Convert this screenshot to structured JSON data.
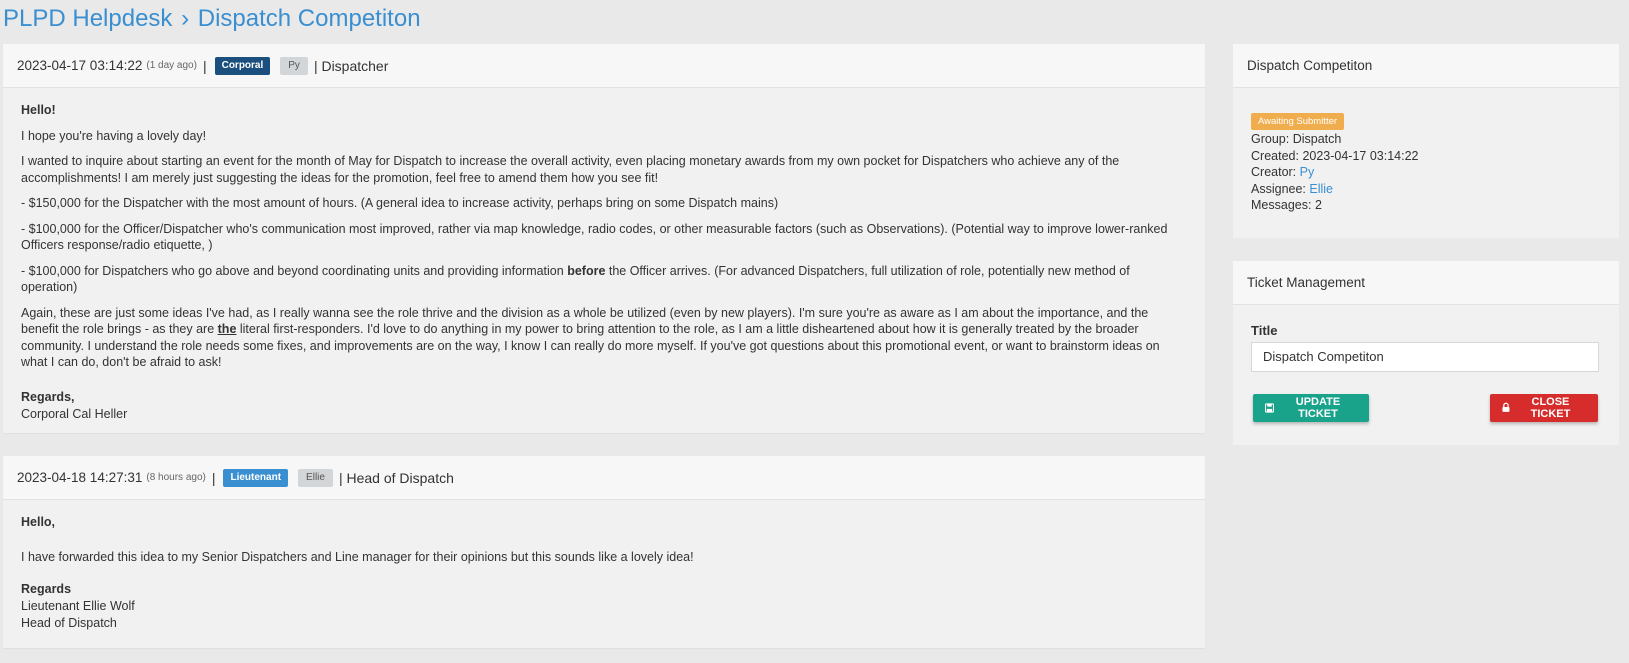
{
  "breadcrumb": {
    "root": "PLPD Helpdesk",
    "separator": "›",
    "current": "Dispatch Competiton"
  },
  "colors": {
    "accent": "#3a8fd1",
    "corporal_badge": "#1a4f7e",
    "lieutenant_badge": "#3a8fd1",
    "awaiting_badge": "#f0ad4e",
    "update_button": "#1aa38b",
    "close_button": "#d62c2c"
  },
  "messages": [
    {
      "timestamp": "2023-04-17 03:14:22",
      "ago": "(1 day ago)",
      "pipe": "|",
      "rank": "Corporal",
      "user": "Py",
      "role": "| Dispatcher",
      "greeting": "Hello!",
      "p1": "I hope you're having a lovely day!",
      "p2": "I wanted to inquire about starting an event for the month of May for Dispatch to increase the overall activity, even placing monetary awards from my own pocket for Dispatchers who achieve any of the accomplishments! I am merely just suggesting the ideas for the promotion, feel free to amend them how you see fit!",
      "b1": "- $150,000 for the Dispatcher with the most amount of hours. (A general idea to increase activity, perhaps bring on some Dispatch mains)",
      "b2": "- $100,000 for the Officer/Dispatcher who's communication most improved, rather via map knowledge, radio codes, or other measurable factors (such as Observations). (Potential way to improve lower-ranked Officers response/radio etiquette, )",
      "b3_pre": "- $100,000 for Dispatchers who go above and beyond coordinating units and providing information ",
      "b3_bold": "before",
      "b3_post": " the Officer arrives. (For advanced Dispatchers, full utilization of role, potentially new method of operation)",
      "p3_pre": "Again, these are just some ideas I've had, as I really wanna see the role thrive and the division as a whole be utilized (even by new players). I'm sure you're as aware as I am about the importance, and the benefit the role brings - as they are ",
      "p3_emph": "the",
      "p3_post": " literal first-responders. I'd love to do anything in my power to bring attention to the role, as I am a little disheartened about how it is generally treated by the broader community. I understand the role needs some fixes, and improvements are on the way, I know I can really do more myself. If you've got questions about this promotional event, or want to brainstorm ideas on what I can do, don't be afraid to ask!",
      "signoff_label": "Regards,",
      "signoff_name": "Corporal Cal Heller"
    },
    {
      "timestamp": "2023-04-18 14:27:31",
      "ago": "(8 hours ago)",
      "pipe": "|",
      "rank": "Lieutenant",
      "user": "Ellie",
      "role": "| Head of Dispatch",
      "greeting": "Hello,",
      "p1": "I have forwarded this idea to my Senior Dispatchers and Line manager for their opinions but this sounds like a lovely idea!",
      "signoff_label": "Regards",
      "signoff_name": "Lieutenant Ellie Wolf",
      "signoff_title": "Head of Dispatch"
    }
  ],
  "details": {
    "title": "Dispatch Competiton",
    "status": "Awaiting Submitter",
    "group_label": "Group:",
    "group": "Dispatch",
    "created_label": "Created:",
    "created": "2023-04-17 03:14:22",
    "creator_label": "Creator:",
    "creator": "Py",
    "assignee_label": "Assignee:",
    "assignee": "Ellie",
    "messages_label": "Messages:",
    "messages": "2"
  },
  "management": {
    "title": "Ticket Management",
    "field_label": "Title",
    "title_value": "Dispatch Competiton",
    "update_label": "UPDATE TICKET",
    "close_label": "CLOSE TICKET",
    "update_icon": "save-icon",
    "close_icon": "lock-icon"
  }
}
